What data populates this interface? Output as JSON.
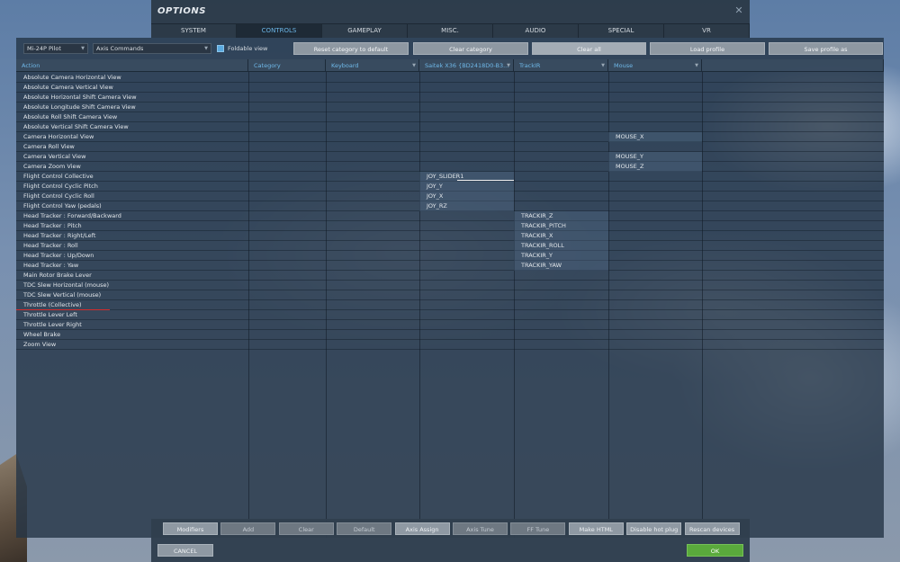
{
  "window": {
    "title": "OPTIONS"
  },
  "tabs": [
    {
      "label": "SYSTEM"
    },
    {
      "label": "CONTROLS"
    },
    {
      "label": "GAMEPLAY"
    },
    {
      "label": "MISC."
    },
    {
      "label": "AUDIO"
    },
    {
      "label": "SPECIAL"
    },
    {
      "label": "VR"
    }
  ],
  "toolbar": {
    "aircraft_select": "Mi-24P Pilot",
    "mode_select": "Axis Commands",
    "foldable_label": "Foldable view",
    "foldable_checked": true,
    "reset_category": "Reset category to default",
    "clear_category": "Clear category",
    "clear_all": "Clear all",
    "load_profile": "Load profile",
    "save_profile": "Save profile as"
  },
  "columns": [
    {
      "label": "Action"
    },
    {
      "label": "Category"
    },
    {
      "label": "Keyboard"
    },
    {
      "label": "Saitek X36 {BD2418D0-B3..."
    },
    {
      "label": "TrackIR"
    },
    {
      "label": "Mouse"
    },
    {
      "label": ""
    }
  ],
  "rows": [
    {
      "action": "Absolute Camera Horizontal View",
      "joy": "",
      "trackir": "",
      "mouse": ""
    },
    {
      "action": "Absolute Camera Vertical View",
      "joy": "",
      "trackir": "",
      "mouse": ""
    },
    {
      "action": "Absolute Horizontal Shift Camera View",
      "joy": "",
      "trackir": "",
      "mouse": ""
    },
    {
      "action": "Absolute Longitude Shift Camera View",
      "joy": "",
      "trackir": "",
      "mouse": ""
    },
    {
      "action": "Absolute Roll Shift Camera View",
      "joy": "",
      "trackir": "",
      "mouse": ""
    },
    {
      "action": "Absolute Vertical Shift Camera View",
      "joy": "",
      "trackir": "",
      "mouse": ""
    },
    {
      "action": "Camera Horizontal View",
      "joy": "",
      "trackir": "",
      "mouse": "MOUSE_X"
    },
    {
      "action": "Camera Roll View",
      "joy": "",
      "trackir": "",
      "mouse": ""
    },
    {
      "action": "Camera Vertical View",
      "joy": "",
      "trackir": "",
      "mouse": "MOUSE_Y"
    },
    {
      "action": "Camera Zoom View",
      "joy": "",
      "trackir": "",
      "mouse": "MOUSE_Z"
    },
    {
      "action": "Flight Control Collective",
      "joy": "JOY_SLIDER1",
      "trackir": "",
      "mouse": ""
    },
    {
      "action": "Flight Control Cyclic Pitch",
      "joy": "JOY_Y",
      "trackir": "",
      "mouse": ""
    },
    {
      "action": "Flight Control Cyclic Roll",
      "joy": "JOY_X",
      "trackir": "",
      "mouse": ""
    },
    {
      "action": "Flight Control Yaw (pedals)",
      "joy": "JOY_RZ",
      "trackir": "",
      "mouse": ""
    },
    {
      "action": "Head Tracker : Forward/Backward",
      "joy": "",
      "trackir": "TRACKIR_Z",
      "mouse": ""
    },
    {
      "action": "Head Tracker : Pitch",
      "joy": "",
      "trackir": "TRACKIR_PITCH",
      "mouse": ""
    },
    {
      "action": "Head Tracker : Right/Left",
      "joy": "",
      "trackir": "TRACKIR_X",
      "mouse": ""
    },
    {
      "action": "Head Tracker : Roll",
      "joy": "",
      "trackir": "TRACKIR_ROLL",
      "mouse": ""
    },
    {
      "action": "Head Tracker : Up/Down",
      "joy": "",
      "trackir": "TRACKIR_Y",
      "mouse": ""
    },
    {
      "action": "Head Tracker : Yaw",
      "joy": "",
      "trackir": "TRACKIR_YAW",
      "mouse": ""
    },
    {
      "action": "Main Rotor Brake Lever",
      "joy": "",
      "trackir": "",
      "mouse": ""
    },
    {
      "action": "TDC Slew Horizontal (mouse)",
      "joy": "",
      "trackir": "",
      "mouse": ""
    },
    {
      "action": "TDC Slew Vertical (mouse)",
      "joy": "",
      "trackir": "",
      "mouse": ""
    },
    {
      "action": "Throttle (Collective)",
      "joy": "",
      "trackir": "",
      "mouse": ""
    },
    {
      "action": "Throttle Lever Left",
      "joy": "",
      "trackir": "",
      "mouse": ""
    },
    {
      "action": "Throttle Lever Right",
      "joy": "",
      "trackir": "",
      "mouse": ""
    },
    {
      "action": "Wheel Brake",
      "joy": "",
      "trackir": "",
      "mouse": ""
    },
    {
      "action": "Zoom View",
      "joy": "",
      "trackir": "",
      "mouse": ""
    }
  ],
  "bottom_buttons": [
    {
      "label": "Modifiers",
      "enabled": true
    },
    {
      "label": "Add",
      "enabled": false
    },
    {
      "label": "Clear",
      "enabled": false
    },
    {
      "label": "Default",
      "enabled": false
    },
    {
      "label": "Axis Assign",
      "enabled": true
    },
    {
      "label": "Axis Tune",
      "enabled": false
    },
    {
      "label": "FF Tune",
      "enabled": false
    },
    {
      "label": "Make HTML",
      "enabled": true
    },
    {
      "label": "Disable hot plug",
      "enabled": true
    },
    {
      "label": "Rescan devices",
      "enabled": true
    }
  ],
  "footer": {
    "cancel": "CANCEL",
    "ok": "OK"
  },
  "colors": {
    "accent": "#6bb5e6",
    "ok_button": "#5aaa3c",
    "highlight_underline": "#d22b2b"
  }
}
